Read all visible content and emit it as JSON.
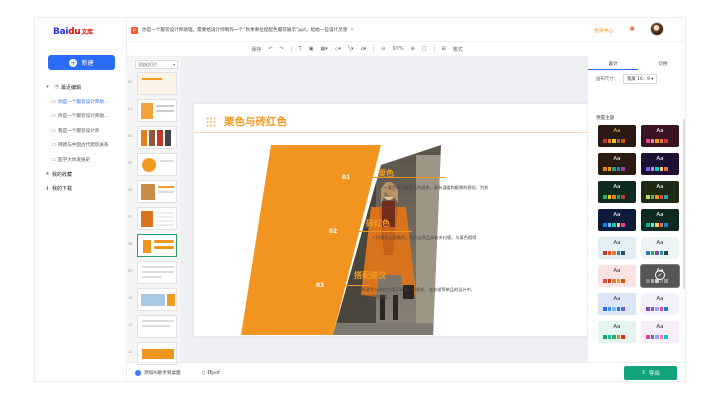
{
  "logo": {
    "brand": "Bai",
    "du": "du",
    "wenku": "文库"
  },
  "sidebar": {
    "new_label": "新建",
    "recent_label": "最近编辑",
    "recent_items": [
      "你是一个服装设计师助...",
      "你是一个服装设计师助...",
      "我是一个服装设计师",
      "佛教与中国古代建筑关系",
      "医学大体发展史"
    ],
    "favorites_label": "我的收藏",
    "downloads_label": "我的下载"
  },
  "topbar": {
    "doc_title": "你是一个服装设计师助理，需要给设计师制作一个“秋季栗拉提配色服装展示”ppt，给她一些设计灵感",
    "vip_label": "会员中心"
  },
  "toolbar": {
    "save": "保存",
    "zoom": "97%",
    "format": "格式"
  },
  "thumbs": {
    "add_label": "添加幻灯片",
    "numbers": [
      "02",
      "03",
      "04",
      "05",
      "06",
      "07",
      "08",
      "09",
      "10",
      "11",
      "12"
    ]
  },
  "slide": {
    "title": "栗色与砖红色",
    "items": [
      {
        "num": "01",
        "title": "栗色",
        "desc_1": "• 栗色象征着秋天的颜色，具有温暖和酿厚的感觉，为秋",
        "desc_2": "彩。"
      },
      {
        "num": "02",
        "title": "砖红色",
        "desc_1": "• 代表泥土的颜色，色彩自然且具有乡村感，与栗色相得",
        "desc_2": ""
      },
      {
        "num": "03",
        "title": "搭配建议",
        "desc_1": "• 将栗色与砖红色用于风衣、针织衫、连衣裙等单品的设计中，",
        "desc_2": "季的自然与温暖。"
      }
    ]
  },
  "right_panel": {
    "tab_design": "设计",
    "tab_switch": "切换",
    "size_label": "画布尺寸：",
    "size_value": "宽屏 16 : 9",
    "preset_label": "预置主题",
    "theme_text": "Aa",
    "themes": [
      {
        "bg": "#2b1a14",
        "fg": "#f0c060",
        "sw": [
          "#c0392b",
          "#e67e22",
          "#f1c40f",
          "#8e5a3a",
          "#d35400"
        ]
      },
      {
        "bg": "#3a1424",
        "fg": "#ffffff",
        "sw": [
          "#e84393",
          "#fd79a8",
          "#f39c12",
          "#e17055",
          "#d63031"
        ]
      },
      {
        "bg": "#2c1b10",
        "fg": "#ffffff",
        "sw": [
          "#e67e22",
          "#f39c12",
          "#16a085",
          "#2980b9",
          "#8e44ad"
        ]
      },
      {
        "bg": "#1d1033",
        "fg": "#ffffff",
        "sw": [
          "#6c5ce7",
          "#a29bfe",
          "#00cec9",
          "#fdcb6e",
          "#e17055"
        ]
      },
      {
        "bg": "#0f2a1e",
        "fg": "#ffffff",
        "sw": [
          "#27ae60",
          "#f1c40f",
          "#e67e22",
          "#16a085",
          "#c0392b"
        ]
      },
      {
        "bg": "#1e2a14",
        "fg": "#ffffff",
        "sw": [
          "#badc58",
          "#6ab04c",
          "#f0932b",
          "#eb4d4b",
          "#22a6b3"
        ]
      },
      {
        "bg": "#0d1b3a",
        "fg": "#ffffff",
        "sw": [
          "#0984e3",
          "#74b9ff",
          "#00cec9",
          "#fdcb6e",
          "#e84393"
        ]
      },
      {
        "bg": "#0f2a20",
        "fg": "#ffffff",
        "sw": [
          "#00b894",
          "#55efc4",
          "#fdcb6e",
          "#e17055",
          "#0984e3"
        ]
      },
      {
        "bg": "#e3f0f3",
        "fg": "#333333",
        "sw": [
          "#c0392b",
          "#e74c3c",
          "#e67e22",
          "#2980b9",
          "#34495e"
        ]
      },
      {
        "bg": "#eef3f6",
        "fg": "#333333",
        "sw": [
          "#2980b9",
          "#27ae60",
          "#8e44ad",
          "#16a085",
          "#2c3e50"
        ]
      },
      {
        "bg": "#fbe3e3",
        "fg": "#333333",
        "sw": [
          "#e74c3c",
          "#c0392b",
          "#e67e22",
          "#f39c12",
          "#d35400"
        ]
      },
      {
        "bg": "#555555",
        "fg": "#ffffff",
        "sw": [
          "#888888",
          "#aaaaaa",
          "#cccccc",
          "#777777",
          "#999999"
        ]
      },
      {
        "bg": "#dde6f6",
        "fg": "#333333",
        "sw": [
          "#2a6cf6",
          "#4a90e2",
          "#74b9ff",
          "#0984e3",
          "#6c5ce7"
        ]
      },
      {
        "bg": "#f4f1fb",
        "fg": "#333333",
        "sw": [
          "#8e44ad",
          "#6c5ce7",
          "#a29bfe",
          "#e84393",
          "#0984e3"
        ]
      },
      {
        "bg": "#e4f4ef",
        "fg": "#333333",
        "sw": [
          "#16a085",
          "#1abc9c",
          "#27ae60",
          "#e67e22",
          "#c0392b"
        ]
      },
      {
        "bg": "#f7eff7",
        "fg": "#333333",
        "sw": [
          "#e84393",
          "#6c5ce7",
          "#a29bfe",
          "#fd79a8",
          "#00cec9"
        ]
      }
    ]
  },
  "bottom": {
    "ai_label": "添加AI助手到桌面",
    "pdf_label": "转pdf",
    "export_label": "导出"
  },
  "colors": {
    "accent": "#f39b21",
    "primary": "#2a6cf6",
    "export": "#14a37f"
  }
}
